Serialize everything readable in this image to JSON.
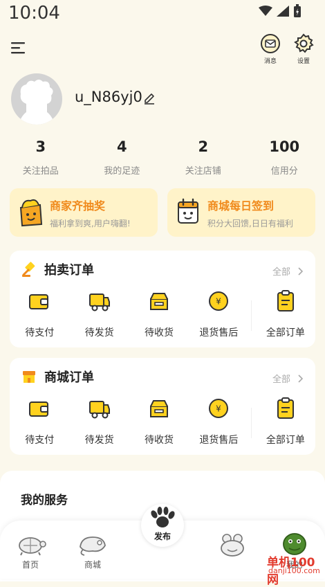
{
  "status": {
    "time": "10:04"
  },
  "topbar": {
    "messages_label": "消息",
    "settings_label": "设置"
  },
  "profile": {
    "username": "u_N86yj0"
  },
  "stats": [
    {
      "value": "3",
      "label": "关注拍品"
    },
    {
      "value": "4",
      "label": "我的足迹"
    },
    {
      "value": "2",
      "label": "关注店铺"
    },
    {
      "value": "100",
      "label": "信用分"
    }
  ],
  "promos": [
    {
      "title": "商家齐抽奖",
      "subtitle": "福利拿到爽,用户嗨翻!"
    },
    {
      "title": "商城每日签到",
      "subtitle": "积分大回馈,日日有福利"
    }
  ],
  "auction_orders": {
    "title": "拍卖订单",
    "all_label": "全部",
    "items": [
      "待支付",
      "待发货",
      "待收货",
      "退货售后",
      "全部订单"
    ]
  },
  "mall_orders": {
    "title": "商城订单",
    "all_label": "全部",
    "items": [
      "待支付",
      "待发货",
      "待收货",
      "退货售后",
      "全部订单"
    ]
  },
  "services": {
    "title": "我的服务"
  },
  "bottom_nav": {
    "home": "首页",
    "mall": "商城",
    "publish": "发布",
    "mine": "我的"
  },
  "watermark": {
    "line1": "单机100网",
    "line2": "danji100.com"
  },
  "colors": {
    "accent": "#FFD21F",
    "orange": "#F08A1C",
    "background": "#FBF8EC"
  }
}
